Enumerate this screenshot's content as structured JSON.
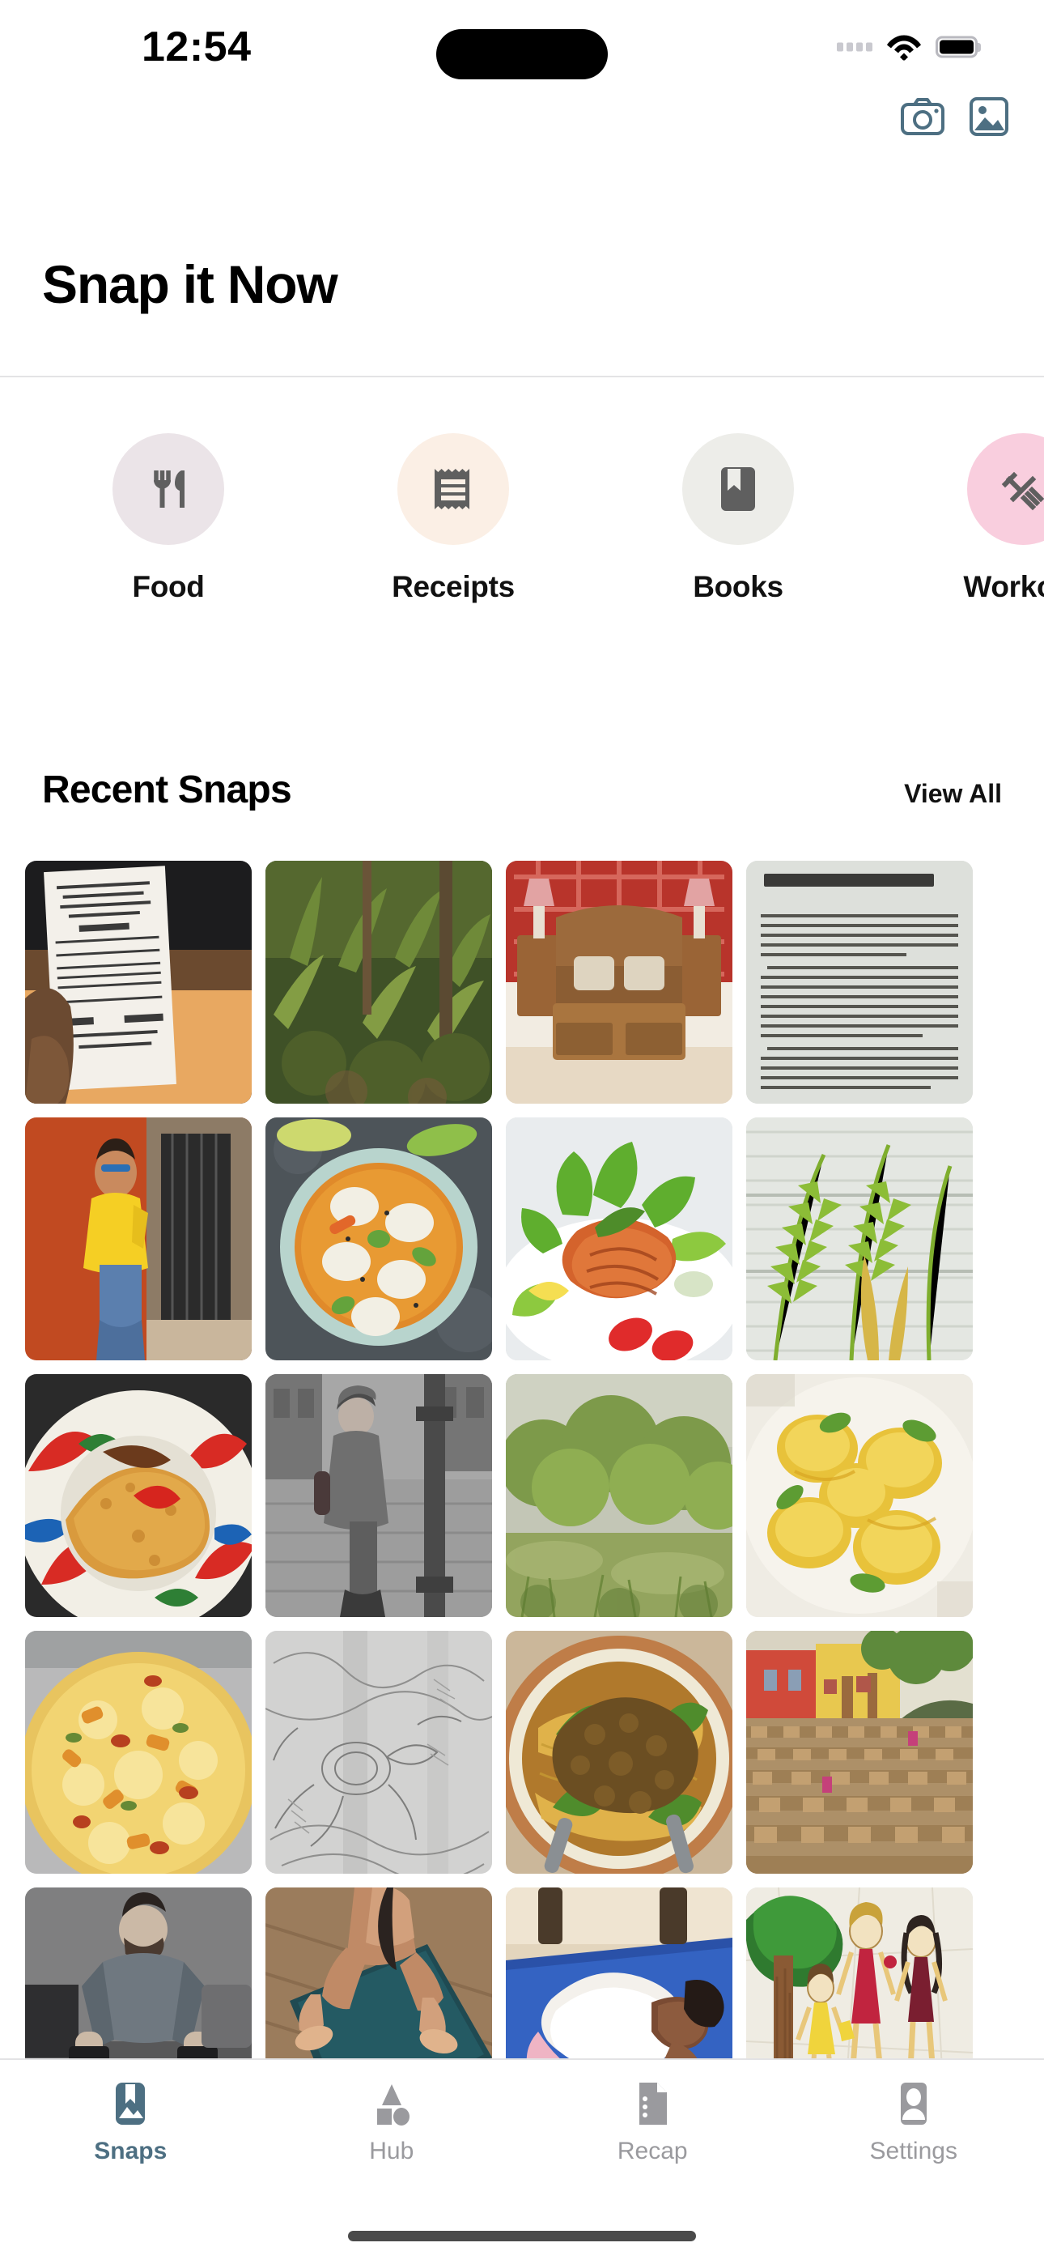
{
  "status_bar": {
    "time": "12:54",
    "signal_icon": "signal-dots-icon",
    "wifi_icon": "wifi-icon",
    "battery_icon": "battery-icon"
  },
  "top_actions": [
    {
      "name": "camera-button",
      "icon": "camera-icon"
    },
    {
      "name": "gallery-button",
      "icon": "photo-library-icon"
    }
  ],
  "header": {
    "title": "Snap it Now"
  },
  "categories": [
    {
      "label": "Food",
      "icon": "fork-knife-icon",
      "circle_color": "#EBE4E8",
      "icon_color": "#5F5F5F"
    },
    {
      "label": "Receipts",
      "icon": "receipt-icon",
      "circle_color": "#FBEFE5",
      "icon_color": "#5F5F5F"
    },
    {
      "label": "Books",
      "icon": "book-bookmark-icon",
      "circle_color": "#EDEDE9",
      "icon_color": "#5F5F5F"
    },
    {
      "label": "Workout",
      "icon": "dumbbell-icon",
      "circle_color": "#F9CEDE",
      "icon_color": "#5F5F5F"
    }
  ],
  "recent_snaps": {
    "title": "Recent Snaps",
    "view_all_label": "View All",
    "tiles": [
      {
        "alt": "restaurant-cash-receipt-in-hand"
      },
      {
        "alt": "banana-plants-forest-undergrowth"
      },
      {
        "alt": "carved-wooden-bed-with-pillows"
      },
      {
        "alt": "book-page-what-i-have-lived-for"
      },
      {
        "alt": "person-yellow-shirt-orange-wall"
      },
      {
        "alt": "dumpling-curry-soup-bowl"
      },
      {
        "alt": "grilled-salmon-salad-plate"
      },
      {
        "alt": "palm-fronds-against-window"
      },
      {
        "alt": "rice-dish-with-chili-on-patterned-plate"
      },
      {
        "alt": "woman-walking-city-street-bw"
      },
      {
        "alt": "green-shrubs-garden"
      },
      {
        "alt": "yellow-curry-dumplings-plate"
      },
      {
        "alt": "cheese-vegetable-pizza"
      },
      {
        "alt": "pencil-sketch-on-paper"
      },
      {
        "alt": "noodle-soup-minced-meat-greens"
      },
      {
        "alt": "village-street-rows-of-stalls"
      },
      {
        "alt": "man-lifting-dumbbells-gym"
      },
      {
        "alt": "woman-plank-pose-yoga-mat"
      },
      {
        "alt": "child-stretching-on-blue-mat"
      },
      {
        "alt": "crayon-drawing-family-and-tree"
      }
    ]
  },
  "tabbar": {
    "items": [
      {
        "label": "Snaps",
        "icon": "photo-bookmark-icon",
        "active": true
      },
      {
        "label": "Hub",
        "icon": "shapes-icon",
        "active": false
      },
      {
        "label": "Recap",
        "icon": "document-icon",
        "active": false
      },
      {
        "label": "Settings",
        "icon": "person-badge-icon",
        "active": false
      }
    ],
    "active_color": "#4D6F82",
    "inactive_color": "#9A9A9E"
  }
}
